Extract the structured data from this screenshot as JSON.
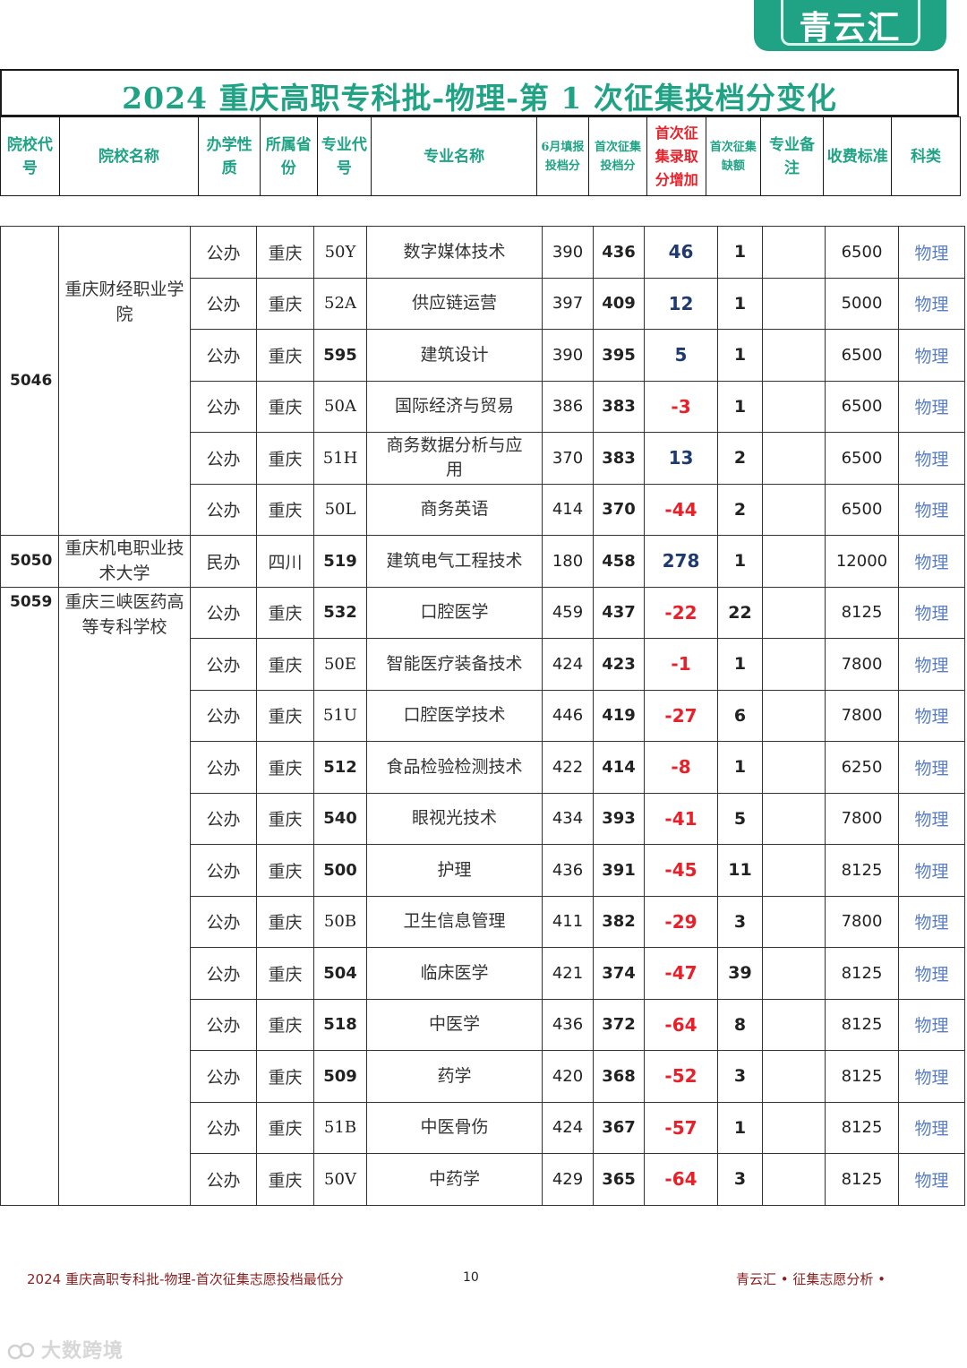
{
  "logo": {
    "text": "青云汇",
    "color": "#1fa384"
  },
  "title": "2024 重庆高职专科批-物理-第 1 次征集投档分变化",
  "header": {
    "school_code": "院校代号",
    "school_name": "院校名称",
    "nature": "办学性质",
    "province": "所属省份",
    "major_code": "专业代号",
    "major_name": "专业名称",
    "june_score": "6月填报投档分",
    "first_score": "首次征集投档分",
    "increase": "首次征集录取分增加",
    "vacancy": "首次征集缺额",
    "remark": "专业备注",
    "fee": "收费标准",
    "subject": "科类"
  },
  "colors": {
    "accent": "#1fa384",
    "negative": "#e8202a",
    "positive": "#1f3a6e",
    "subject": "#5a7ec6"
  },
  "schools": [
    {
      "code": "5046",
      "name": "重庆财经职业学院",
      "rows": [
        {
          "nature": "公办",
          "province": "重庆",
          "major_code": "50Y",
          "major_name": "数字媒体技术",
          "june": "390",
          "first": "436",
          "inc": "46",
          "vacancy": "1",
          "remark": "",
          "fee": "6500",
          "subject": "物理"
        },
        {
          "nature": "公办",
          "province": "重庆",
          "major_code": "52A",
          "major_name": "供应链运营",
          "june": "397",
          "first": "409",
          "inc": "12",
          "vacancy": "1",
          "remark": "",
          "fee": "5000",
          "subject": "物理"
        },
        {
          "nature": "公办",
          "province": "重庆",
          "major_code": "595",
          "major_name": "建筑设计",
          "june": "390",
          "first": "395",
          "inc": "5",
          "vacancy": "1",
          "remark": "",
          "fee": "6500",
          "subject": "物理"
        },
        {
          "nature": "公办",
          "province": "重庆",
          "major_code": "50A",
          "major_name": "国际经济与贸易",
          "june": "386",
          "first": "383",
          "inc": "-3",
          "vacancy": "1",
          "remark": "",
          "fee": "6500",
          "subject": "物理"
        },
        {
          "nature": "公办",
          "province": "重庆",
          "major_code": "51H",
          "major_name": "商务数据分析与应用",
          "june": "370",
          "first": "383",
          "inc": "13",
          "vacancy": "2",
          "remark": "",
          "fee": "6500",
          "subject": "物理"
        },
        {
          "nature": "公办",
          "province": "重庆",
          "major_code": "50L",
          "major_name": "商务英语",
          "june": "414",
          "first": "370",
          "inc": "-44",
          "vacancy": "2",
          "remark": "",
          "fee": "6500",
          "subject": "物理"
        }
      ]
    },
    {
      "code": "5050",
      "name": "重庆机电职业技术大学",
      "rows": [
        {
          "nature": "民办",
          "province": "四川",
          "major_code": "519",
          "major_name": "建筑电气工程技术",
          "june": "180",
          "first": "458",
          "inc": "278",
          "vacancy": "1",
          "remark": "",
          "fee": "12000",
          "subject": "物理"
        }
      ]
    },
    {
      "code": "5059",
      "name": "重庆三峡医药高等专科学校",
      "rows": [
        {
          "nature": "公办",
          "province": "重庆",
          "major_code": "532",
          "major_name": "口腔医学",
          "june": "459",
          "first": "437",
          "inc": "-22",
          "vacancy": "22",
          "remark": "",
          "fee": "8125",
          "subject": "物理"
        },
        {
          "nature": "公办",
          "province": "重庆",
          "major_code": "50E",
          "major_name": "智能医疗装备技术",
          "june": "424",
          "first": "423",
          "inc": "-1",
          "vacancy": "1",
          "remark": "",
          "fee": "7800",
          "subject": "物理"
        },
        {
          "nature": "公办",
          "province": "重庆",
          "major_code": "51U",
          "major_name": "口腔医学技术",
          "june": "446",
          "first": "419",
          "inc": "-27",
          "vacancy": "6",
          "remark": "",
          "fee": "7800",
          "subject": "物理"
        },
        {
          "nature": "公办",
          "province": "重庆",
          "major_code": "512",
          "major_name": "食品检验检测技术",
          "june": "422",
          "first": "414",
          "inc": "-8",
          "vacancy": "1",
          "remark": "",
          "fee": "6250",
          "subject": "物理"
        },
        {
          "nature": "公办",
          "province": "重庆",
          "major_code": "540",
          "major_name": "眼视光技术",
          "june": "434",
          "first": "393",
          "inc": "-41",
          "vacancy": "5",
          "remark": "",
          "fee": "7800",
          "subject": "物理"
        },
        {
          "nature": "公办",
          "province": "重庆",
          "major_code": "500",
          "major_name": "护理",
          "june": "436",
          "first": "391",
          "inc": "-45",
          "vacancy": "11",
          "remark": "",
          "fee": "8125",
          "subject": "物理"
        },
        {
          "nature": "公办",
          "province": "重庆",
          "major_code": "50B",
          "major_name": "卫生信息管理",
          "june": "411",
          "first": "382",
          "inc": "-29",
          "vacancy": "3",
          "remark": "",
          "fee": "7800",
          "subject": "物理"
        },
        {
          "nature": "公办",
          "province": "重庆",
          "major_code": "504",
          "major_name": "临床医学",
          "june": "421",
          "first": "374",
          "inc": "-47",
          "vacancy": "39",
          "remark": "",
          "fee": "8125",
          "subject": "物理"
        },
        {
          "nature": "公办",
          "province": "重庆",
          "major_code": "518",
          "major_name": "中医学",
          "june": "436",
          "first": "372",
          "inc": "-64",
          "vacancy": "8",
          "remark": "",
          "fee": "8125",
          "subject": "物理"
        },
        {
          "nature": "公办",
          "province": "重庆",
          "major_code": "509",
          "major_name": "药学",
          "june": "420",
          "first": "368",
          "inc": "-52",
          "vacancy": "3",
          "remark": "",
          "fee": "8125",
          "subject": "物理"
        },
        {
          "nature": "公办",
          "province": "重庆",
          "major_code": "51B",
          "major_name": "中医骨伤",
          "june": "424",
          "first": "367",
          "inc": "-57",
          "vacancy": "1",
          "remark": "",
          "fee": "8125",
          "subject": "物理"
        },
        {
          "nature": "公办",
          "province": "重庆",
          "major_code": "50V",
          "major_name": "中药学",
          "june": "429",
          "first": "365",
          "inc": "-64",
          "vacancy": "3",
          "remark": "",
          "fee": "8125",
          "subject": "物理"
        }
      ]
    }
  ],
  "footer": {
    "left": "2024 重庆高职专科批-物理-首次征集志愿投档最低分",
    "page": "10",
    "right": "青云汇 • 征集志愿分析 •"
  },
  "watermark": "大数跨境"
}
